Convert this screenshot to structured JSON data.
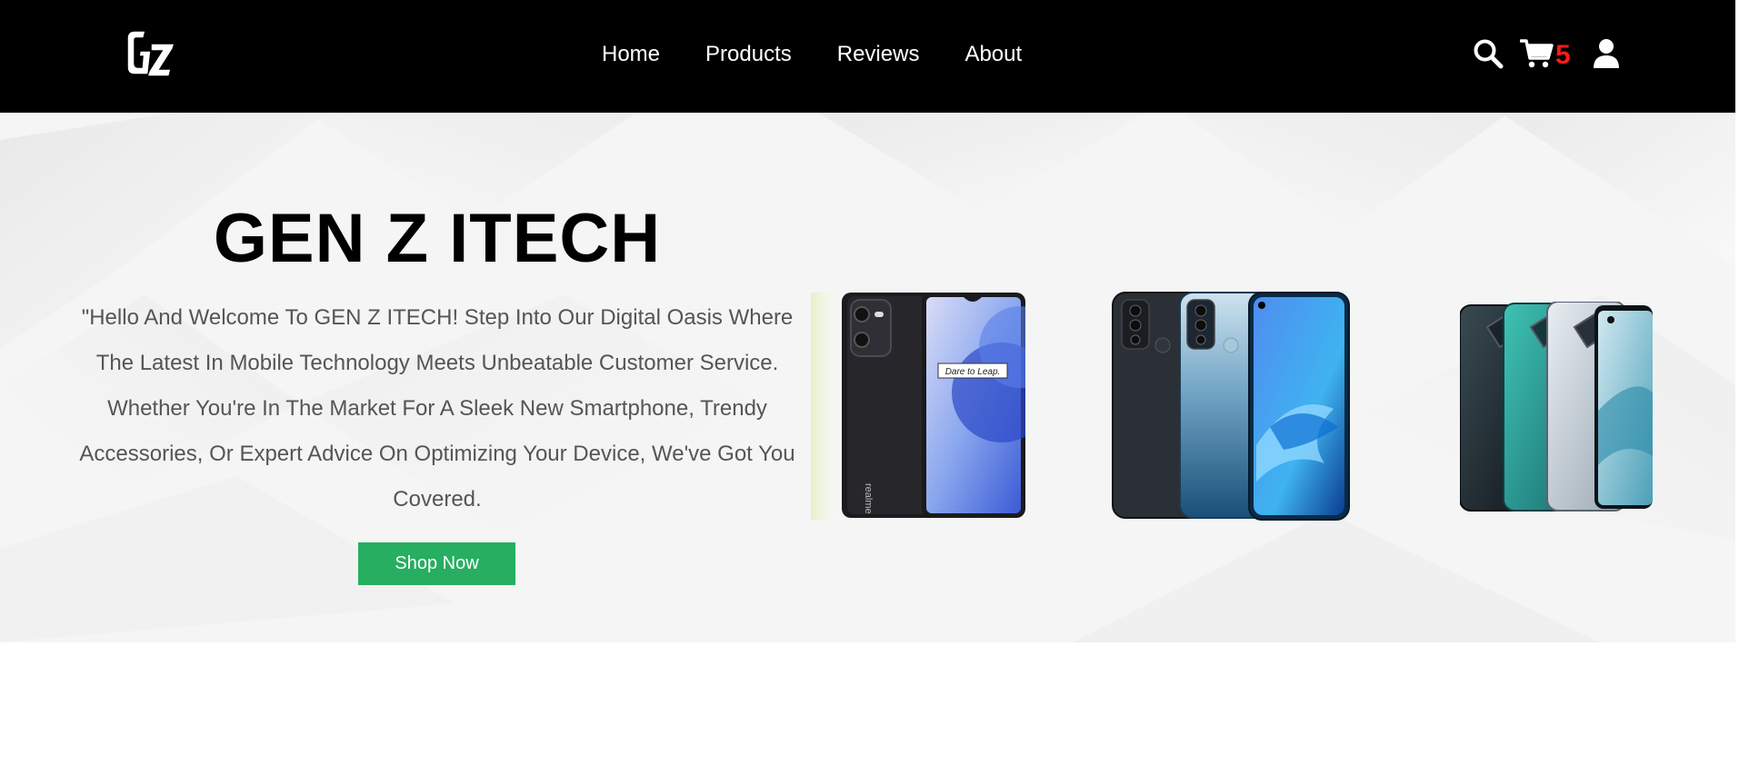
{
  "brand": {
    "logo_text": "GZ"
  },
  "nav": {
    "links": [
      "Home",
      "Products",
      "Reviews",
      "About"
    ],
    "cart_count": "5"
  },
  "hero": {
    "title": "GEN Z ITECH",
    "description": "\"Hello And Welcome To GEN Z ITECH! Step Into Our Digital Oasis Where The Latest In Mobile Technology Meets Unbeatable Customer Service. Whether You're In The Market For A Sleek New Smartphone, Trendy Accessories, Or Expert Advice On Optimizing Your Device, We've Got You Covered.",
    "cta_label": "Shop Now",
    "phones": [
      {
        "icon": "realme-phone-image",
        "screen_text": "Dare to Leap.",
        "brand_text": "realme"
      },
      {
        "icon": "oppo-phones-image"
      },
      {
        "icon": "infinix-phones-image"
      }
    ]
  },
  "colors": {
    "navbar": "#000000",
    "cta": "#27ae60",
    "cart_badge": "#ff1a1a",
    "hero_text": "#555555"
  }
}
